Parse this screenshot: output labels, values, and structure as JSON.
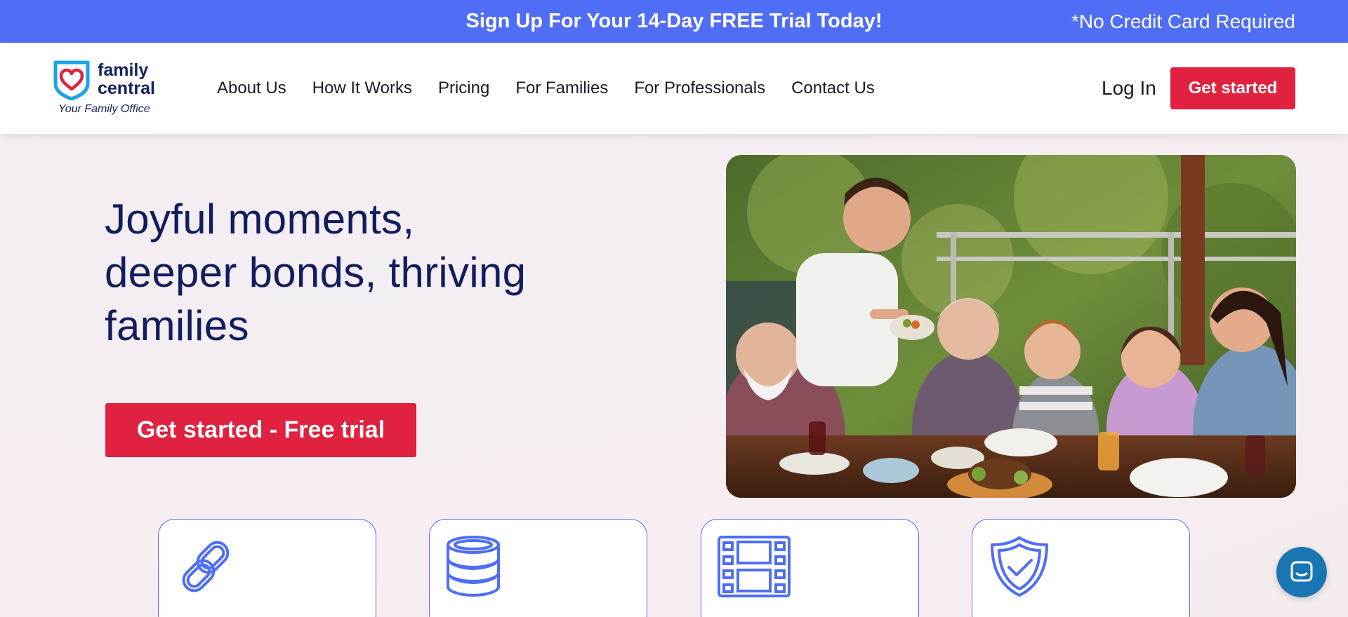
{
  "promo": {
    "headline": "Sign Up For Your 14-Day FREE Trial Today!",
    "note": "*No Credit Card Required"
  },
  "brand": {
    "line1": "family",
    "line2": "central",
    "tagline": "Your Family Office"
  },
  "nav": {
    "items": [
      {
        "label": "About Us"
      },
      {
        "label": "How It Works"
      },
      {
        "label": "Pricing"
      },
      {
        "label": "For Families"
      },
      {
        "label": "For Professionals"
      },
      {
        "label": "Contact Us"
      }
    ],
    "login": "Log In",
    "cta": "Get started"
  },
  "hero": {
    "title_lines": [
      "Joyful moments,",
      "deeper bonds, thriving",
      "families"
    ],
    "cta": "Get started - Free trial"
  },
  "features": {
    "icons": [
      "link-icon",
      "database-icon",
      "film-icon",
      "shield-check-icon"
    ]
  },
  "colors": {
    "accent": "#4f6ef5",
    "cta": "#e0213f",
    "heading": "#121d5e",
    "chat": "#1a76b3"
  }
}
